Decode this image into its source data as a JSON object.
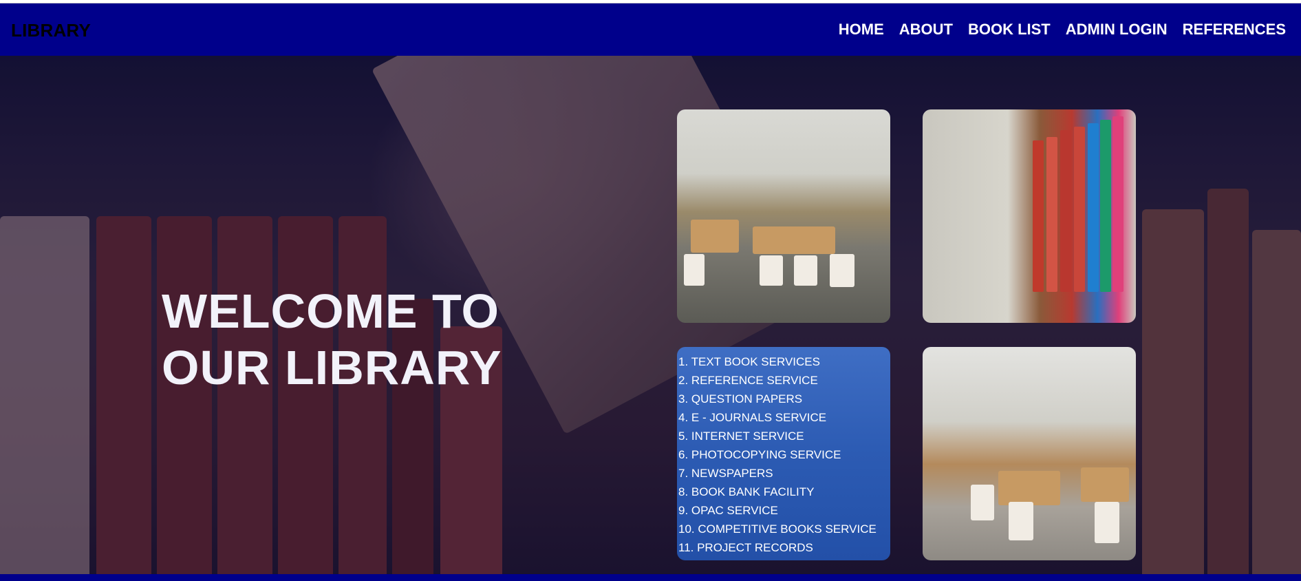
{
  "navbar": {
    "brand": "LIBRARY",
    "items": [
      {
        "label": "HOME"
      },
      {
        "label": "ABOUT"
      },
      {
        "label": "BOOK LIST"
      },
      {
        "label": "ADMIN LOGIN"
      },
      {
        "label": "REFERENCES"
      }
    ]
  },
  "hero": {
    "title_line1": "WELCOME TO",
    "title_line2": "OUR LIBRARY"
  },
  "gallery": {
    "services": [
      "1. TEXT BOOK SERVICES",
      "2. REFERENCE SERVICE",
      "3. QUESTION PAPERS",
      "4. E - JOURNALS SERVICE",
      "5. INTERNET SERVICE",
      "6. PHOTOCOPYING SERVICE",
      "7. NEWSPAPERS",
      "8. BOOK BANK FACILITY",
      "9. OPAC SERVICE",
      "10. COMPETITIVE BOOKS SERVICE",
      "11. PROJECT RECORDS"
    ]
  },
  "colors": {
    "navbar": "#00008b",
    "nav_text": "#ffffff",
    "brand_text": "#000000",
    "hero_text": "#f2f2fa"
  }
}
